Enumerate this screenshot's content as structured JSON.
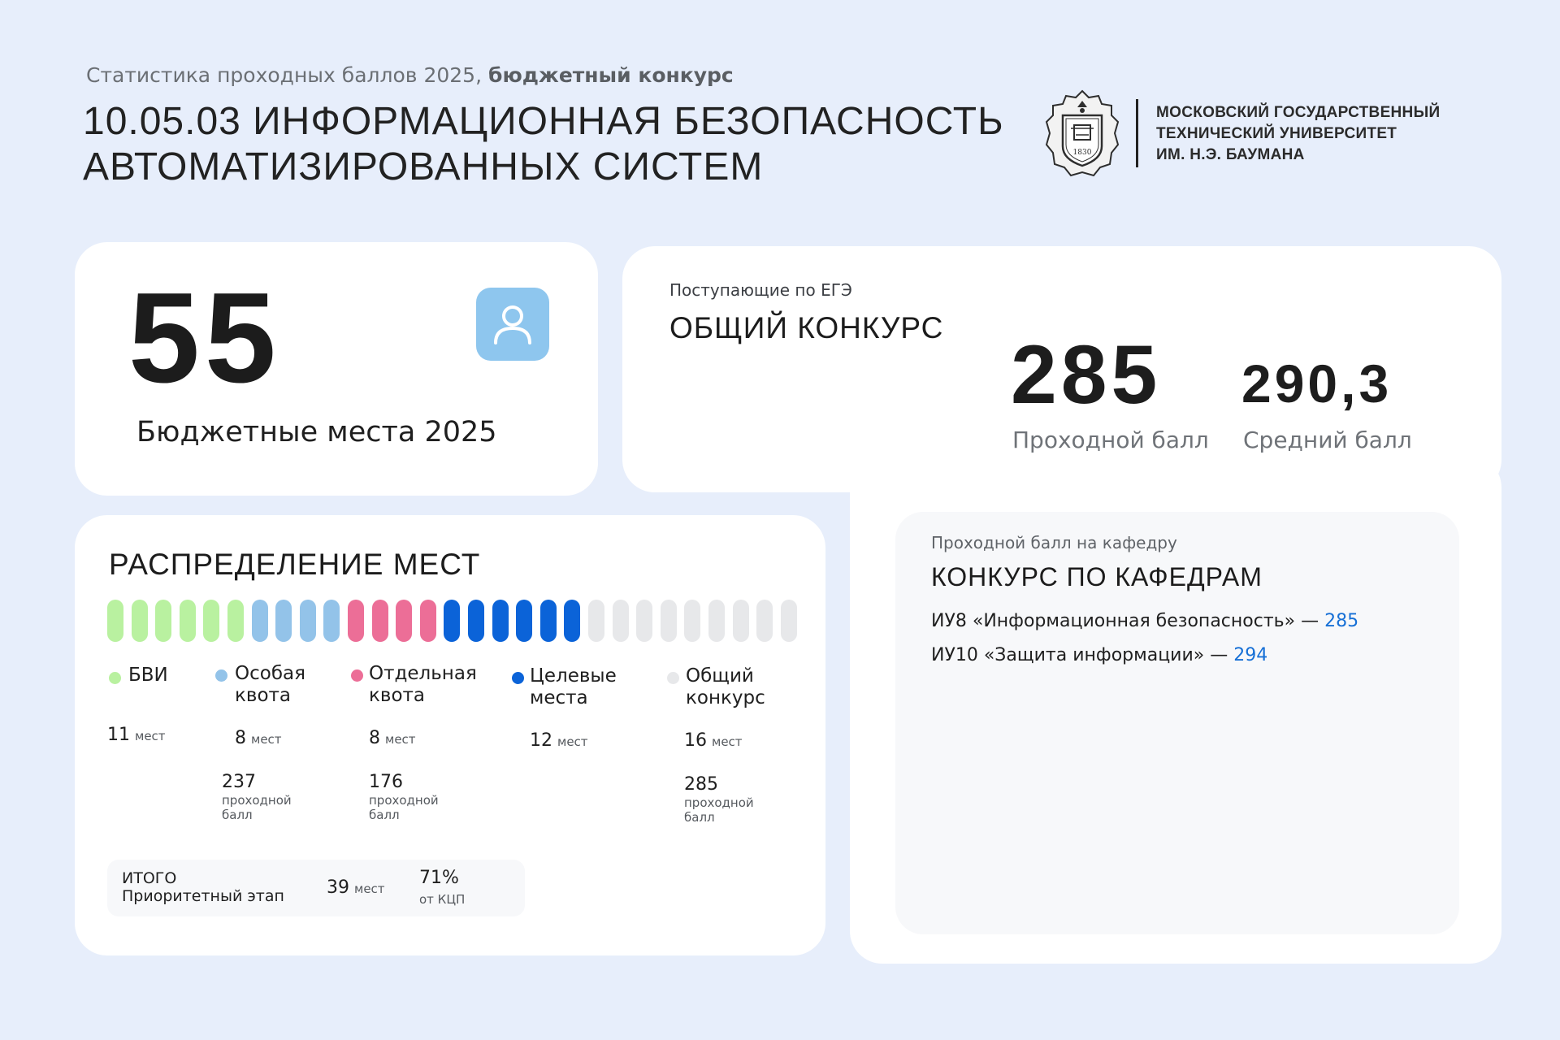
{
  "header": {
    "subtitle_regular": "Статистика проходных баллов 2025,",
    "subtitle_bold": "бюджетный конкурс",
    "title_line1": "10.05.03 ИНФОРМАЦИОННАЯ БЕЗОПАСНОСТЬ",
    "title_line2": "АВТОМАТИЗИРОВАННЫХ СИСТЕМ",
    "university_line1": "МОСКОВСКИЙ ГОСУДАРСТВЕННЫЙ",
    "university_line2": "ТЕХНИЧЕСКИЙ УНИВЕРСИТЕТ",
    "university_line3": "ИМ. Н.Э. БАУМАНА",
    "logo_year": "1830"
  },
  "seats": {
    "value": "55",
    "label": "Бюджетные места 2025",
    "icon": "user-icon"
  },
  "general": {
    "small_label": "Поступающие по ЕГЭ",
    "heading": "ОБЩИЙ КОНКУРС",
    "passing_value": "285",
    "passing_label": "Проходной балл",
    "average_value": "290,3",
    "average_label": "Средний балл"
  },
  "departments": {
    "small_label": "Проходной балл на кафедру",
    "heading": "КОНКУРС ПО КАФЕДРАМ",
    "items": [
      {
        "text": "ИУ8 «Информационная безопасность» — ",
        "value": "285"
      },
      {
        "text": "ИУ10 «Защита информации» — ",
        "value": "294"
      }
    ]
  },
  "distribution": {
    "heading": "РАСПРЕДЕЛЕНИЕ МЕСТ",
    "seats_word": "мест",
    "pass_word_1": "проходной",
    "pass_word_2": "балл",
    "categories": [
      {
        "line1": "БВИ",
        "line2": "",
        "count": "11",
        "pass": "",
        "color": "#b9f1a0"
      },
      {
        "line1": "Особая",
        "line2": "квота",
        "count": "8",
        "pass": "237",
        "color": "#93c3e9"
      },
      {
        "line1": "Отдельная",
        "line2": "квота",
        "count": "8",
        "pass": "176",
        "color": "#ec6e97"
      },
      {
        "line1": "Целевые",
        "line2": "места",
        "count": "12",
        "pass": "",
        "color": "#0b63d8"
      },
      {
        "line1": "Общий",
        "line2": "конкурс",
        "count": "16",
        "pass": "285",
        "color": "#e7e8ea"
      }
    ],
    "pill_counts": [
      6,
      4,
      4,
      6,
      9
    ],
    "total": {
      "label1": "ИТОГО",
      "label2": "Приоритетный этап",
      "count": "39",
      "percent": "71%",
      "percent_label": "от КЦП"
    }
  }
}
